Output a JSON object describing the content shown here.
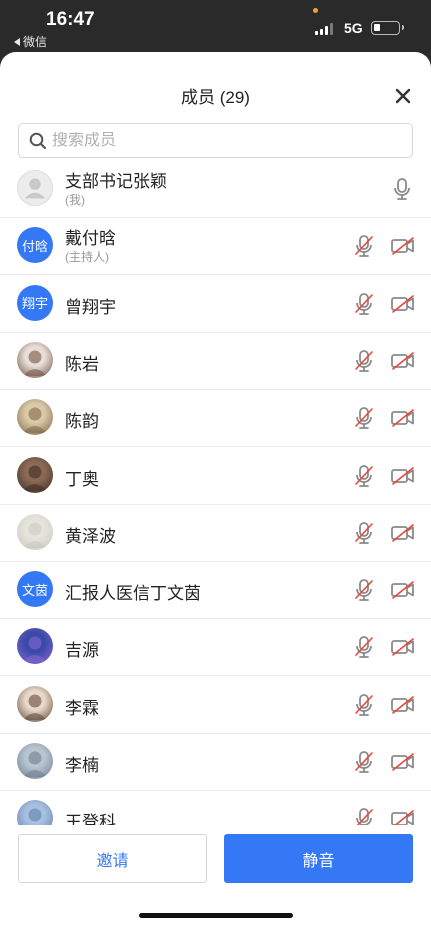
{
  "status_bar": {
    "time": "16:47",
    "back_label": "微信",
    "network": "5G"
  },
  "panel": {
    "title": "成员 (29)"
  },
  "search": {
    "placeholder": "搜索成员",
    "value": ""
  },
  "members": [
    {
      "name": "支部书记张颖",
      "role": "(我)",
      "avatar_type": "placeholder",
      "avatar_text": "",
      "mic_muted": false,
      "show_camera": false
    },
    {
      "name": "戴付晗",
      "role": "(主持人)",
      "avatar_type": "text",
      "avatar_text": "付晗",
      "mic_muted": true,
      "show_camera": true
    },
    {
      "name": "曾翔宇",
      "role": "",
      "avatar_type": "text",
      "avatar_text": "翔宇",
      "mic_muted": true,
      "show_camera": true
    },
    {
      "name": "陈岩",
      "role": "",
      "avatar_type": "photo",
      "avatar_text": "",
      "photo_colors": [
        "#e8ded8",
        "#6b4a3a"
      ],
      "mic_muted": true,
      "show_camera": true
    },
    {
      "name": "陈韵",
      "role": "",
      "avatar_type": "photo",
      "avatar_text": "",
      "photo_colors": [
        "#d9c9a8",
        "#7a6040"
      ],
      "mic_muted": true,
      "show_camera": true
    },
    {
      "name": "丁奥",
      "role": "",
      "avatar_type": "photo",
      "avatar_text": "",
      "photo_colors": [
        "#8a6a55",
        "#3a2a22"
      ],
      "mic_muted": true,
      "show_camera": true
    },
    {
      "name": "黄泽波",
      "role": "",
      "avatar_type": "photo",
      "avatar_text": "",
      "photo_colors": [
        "#e4e4dc",
        "#c8c8bc"
      ],
      "mic_muted": true,
      "show_camera": true
    },
    {
      "name": "汇报人医信丁文茵",
      "role": "",
      "avatar_type": "text",
      "avatar_text": "文茵",
      "mic_muted": true,
      "show_camera": true
    },
    {
      "name": "吉源",
      "role": "",
      "avatar_type": "photo",
      "avatar_text": "",
      "photo_colors": [
        "#3a4aa8",
        "#8a6ad0"
      ],
      "mic_muted": true,
      "show_camera": true
    },
    {
      "name": "李霖",
      "role": "",
      "avatar_type": "photo",
      "avatar_text": "",
      "photo_colors": [
        "#e8d8c8",
        "#5a4030"
      ],
      "mic_muted": true,
      "show_camera": true
    },
    {
      "name": "李楠",
      "role": "",
      "avatar_type": "photo",
      "avatar_text": "",
      "photo_colors": [
        "#b8c4d0",
        "#6a7a8c"
      ],
      "mic_muted": true,
      "show_camera": true
    },
    {
      "name": "王登科",
      "role": "",
      "avatar_type": "photo",
      "avatar_text": "",
      "photo_colors": [
        "#a8c0e0",
        "#5a7aa8"
      ],
      "mic_muted": true,
      "show_camera": true
    }
  ],
  "footer": {
    "invite_label": "邀请",
    "mute_label": "静音"
  },
  "colors": {
    "accent": "#3478f6",
    "muted_red": "#e8483b",
    "icon_gray": "#8a8a8a"
  }
}
